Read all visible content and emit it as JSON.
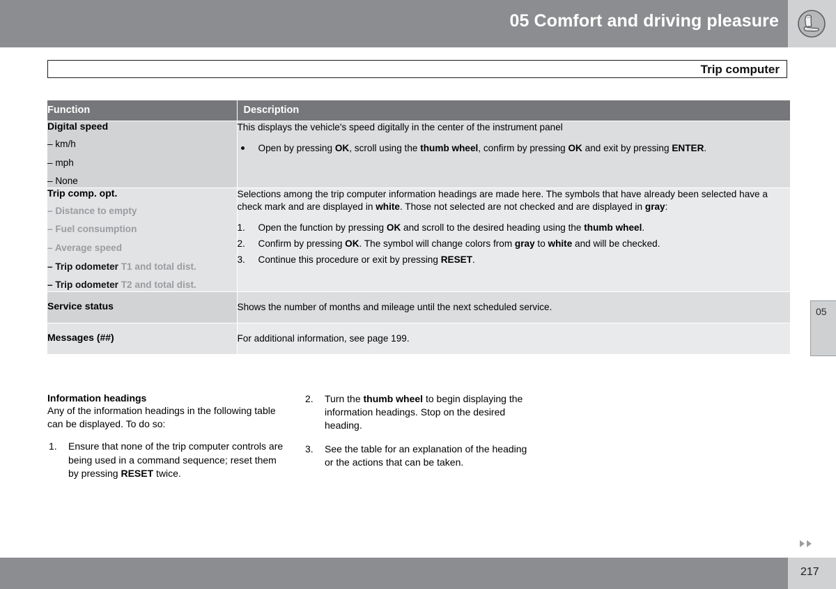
{
  "header": {
    "chapter_title": "05 Comfort and driving pleasure",
    "icon": "car-seat-icon",
    "bar_color": "#8b8d90",
    "text_color": "#ffffff"
  },
  "section": {
    "title": "Trip computer"
  },
  "table": {
    "columns": [
      "Function",
      "Description"
    ],
    "rows": [
      {
        "function_title": "Digital speed",
        "function_items": [
          {
            "text": "– km/h",
            "style": "normal"
          },
          {
            "text": "– mph",
            "style": "normal"
          },
          {
            "text": "– None",
            "style": "normal"
          }
        ],
        "description_intro": "This displays the vehicle's speed digitally in the center of the instrument panel",
        "bullets": [
          "Open by pressing OK, scroll using the thumb wheel, confirm by pressing OK and exit by pressing ENTER."
        ],
        "steps": []
      },
      {
        "function_title": "Trip comp. opt.",
        "function_items": [
          {
            "text": "– Distance to empty",
            "style": "gray"
          },
          {
            "text": "– Fuel consumption",
            "style": "gray"
          },
          {
            "text": "– Average speed",
            "style": "gray"
          },
          {
            "text": "– Trip odometer ",
            "gray_suffix": "T1 and total dist.",
            "style": "mixed"
          },
          {
            "text": "– Trip odometer ",
            "gray_suffix": "T2 and total dist.",
            "style": "mixed"
          }
        ],
        "description_intro": "Selections among the trip computer information headings are made here. The symbols that have already been selected have a check mark and are displayed in white. Those not selected are not checked and are displayed in gray:",
        "bullets": [],
        "steps": [
          "Open the function by pressing OK and scroll to the desired heading using the thumb wheel.",
          "Confirm by pressing OK. The symbol will change colors from gray to white and will be checked.",
          "Continue this procedure or exit by pressing RESET."
        ]
      },
      {
        "function_title": "Service status",
        "function_items": [],
        "description_intro": "Shows the number of months and mileage until the next scheduled service.",
        "bullets": [],
        "steps": []
      },
      {
        "function_title": "Messages (##)",
        "function_items": [],
        "description_intro": "For additional information, see page 199.",
        "bullets": [],
        "steps": []
      }
    ]
  },
  "lower_section": {
    "heading": "Information headings",
    "intro": "Any of the information headings in the following table can be displayed. To do so:",
    "steps": [
      {
        "num": "1.",
        "text": "Ensure that none of the trip computer controls are being used in a command sequence; reset them by pressing RESET twice."
      },
      {
        "num": "2.",
        "text": "Turn the thumb wheel to begin displaying the information headings. Stop on the desired heading."
      },
      {
        "num": "3.",
        "text": "See the table for an explanation of the heading or the actions that can be taken."
      }
    ]
  },
  "side_tab": {
    "label": "05"
  },
  "footer": {
    "page_number": "217",
    "arrows": "double-right-arrow-icon"
  }
}
